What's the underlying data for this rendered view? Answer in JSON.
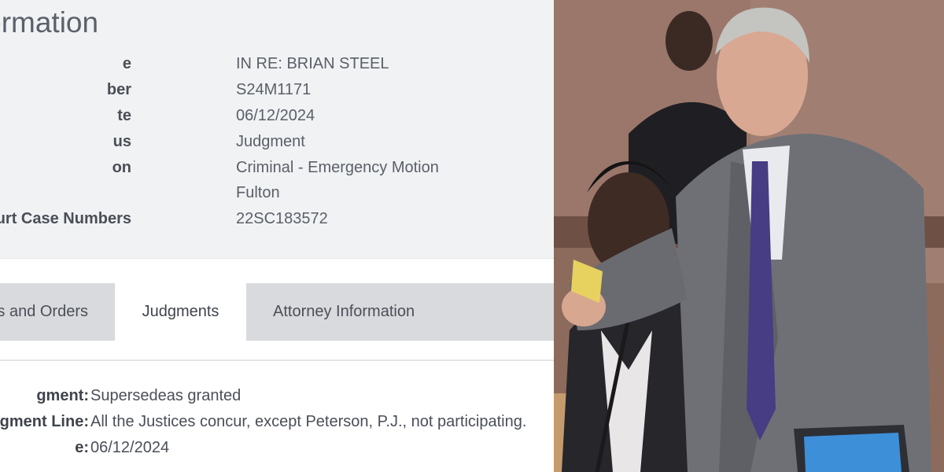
{
  "case_info": {
    "title": "Information",
    "fields": [
      {
        "label": "e",
        "value": "IN RE: BRIAN STEEL"
      },
      {
        "label": "ber",
        "value": "S24M1171"
      },
      {
        "label": "te",
        "value": "06/12/2024"
      },
      {
        "label": "us",
        "value": "Judgment"
      },
      {
        "label": "on",
        "value": "Criminal - Emergency Motion"
      },
      {
        "label": "",
        "value": "Fulton"
      },
      {
        "label": "urt Case Numbers",
        "value": "22SC183572"
      }
    ]
  },
  "tabs": [
    {
      "label": "s and Orders",
      "active": false
    },
    {
      "label": "Judgments",
      "active": true
    },
    {
      "label": "Attorney Information",
      "active": false
    }
  ],
  "judgment": {
    "rows": [
      {
        "label": "gment:",
        "value": "Supersedeas granted"
      },
      {
        "label": "gment Line:",
        "value": "All the Justices concur, except Peterson, P.J., not participating."
      },
      {
        "label": "e:",
        "value": "06/12/2024"
      }
    ]
  },
  "photo": {
    "description_icon": "courtroom-photo",
    "colors": {
      "wall": "#8a6a5c",
      "suit": "#6d6e72",
      "tie": "#4a3f86",
      "dark_suit": "#2a2a2e"
    }
  }
}
